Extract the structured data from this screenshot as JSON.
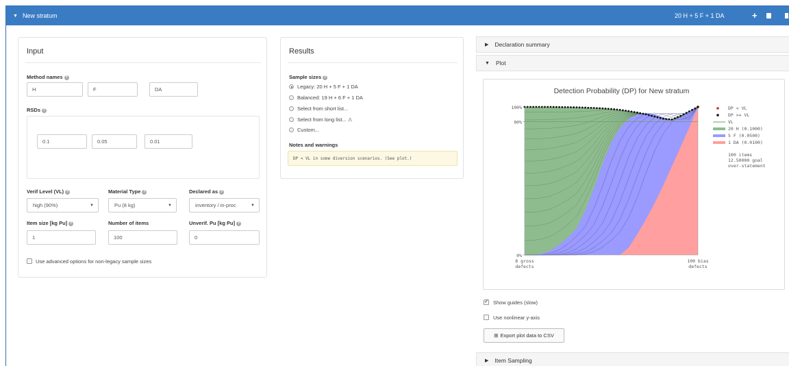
{
  "stratum": {
    "title": "New stratum",
    "summary": "20 H + 5 F + 1 DA"
  },
  "input": {
    "title": "Input",
    "method_names_label": "Method names",
    "methods": [
      "H",
      "F",
      "DA"
    ],
    "rsds_label": "RSDs",
    "rsds": [
      "0.1",
      "0.05",
      "0.01"
    ],
    "verif_level": {
      "label": "Verif Level (VL)",
      "value": "high (90%)"
    },
    "material_type": {
      "label": "Material Type",
      "value": "Pu (8 kg)"
    },
    "declared_as": {
      "label": "Declared as",
      "value": "inventory / in-proc"
    },
    "item_size": {
      "label": "Item size [kg Pu]",
      "value": "1"
    },
    "num_items": {
      "label": "Number of items",
      "value": "100"
    },
    "unverif": {
      "label": "Unverif. Pu [kg Pu]",
      "value": "0"
    },
    "advanced_label": "Use advanced options for non-legacy sample sizes"
  },
  "results": {
    "title": "Results",
    "sample_sizes_label": "Sample sizes",
    "options": [
      "Legacy: 20 H + 5 F + 1 DA",
      "Balanced: 19 H + 6 F + 1 DA",
      "Select from short list...",
      "Select from long list...",
      "Custom..."
    ],
    "selected_index": 0,
    "notes_label": "Notes and warnings",
    "warning": "DP < VL in some diversion scenarios. (See plot.)"
  },
  "right": {
    "declaration_summary": "Declaration summary",
    "plot": "Plot",
    "show_guides": "Show guides (slow)",
    "nonlinear": "Use nonlinear y-axis",
    "export": "Export plot data to CSV",
    "item_sampling": "Item Sampling"
  },
  "chart_data": {
    "type": "area",
    "title": "Detection Probability (DP) for New stratum",
    "y_ticks": [
      "100%",
      "90%",
      "0%"
    ],
    "x_labels": [
      "8 gross\ndefects",
      "100 bias\ndefects"
    ],
    "x_label_left": [
      "8 gross",
      "defects"
    ],
    "x_label_right": [
      "100 bias",
      "defects"
    ],
    "ylim": [
      0,
      1
    ],
    "vl": 0.9,
    "legend": [
      {
        "name": "DP < VL",
        "color": "#d62728",
        "kind": "dot"
      },
      {
        "name": "DP >= VL",
        "color": "#111111",
        "kind": "dot"
      },
      {
        "name": "VL",
        "color": "#6aa06a",
        "kind": "line"
      },
      {
        "name": "20 H (0.1000)",
        "color": "#8fbc8f",
        "kind": "band"
      },
      {
        "name": "5 F (0.0500)",
        "color": "#9a9aff",
        "kind": "band"
      },
      {
        "name": "1 DA (0.0100)",
        "color": "#ff9f9f",
        "kind": "band"
      }
    ],
    "annotation": [
      "100 items",
      "12.50000 goal",
      "over-statement"
    ],
    "series": [
      {
        "name": "20 H (0.1000)",
        "values": [
          1.0,
          1.0,
          1.0,
          1.0,
          0.999,
          0.998,
          0.997,
          0.995,
          0.993,
          0.99,
          0.986,
          0.98,
          0.972,
          0.962,
          0.95,
          0.935,
          0.92,
          0.915,
          0.94,
          0.97,
          1.0
        ]
      },
      {
        "name": "5 F (0.0500)",
        "values": [
          0.0,
          0.0,
          0.01,
          0.03,
          0.07,
          0.12,
          0.18,
          0.3,
          0.45,
          0.62,
          0.76,
          0.86,
          0.92,
          0.95,
          0.96,
          0.95,
          0.93,
          0.91,
          0.93,
          0.97,
          1.0
        ]
      },
      {
        "name": "1 DA (0.0100)",
        "values": [
          0.0,
          0.0,
          0.0,
          0.0,
          0.0,
          0.0,
          0.0,
          0.0,
          0.0,
          0.0,
          0.0,
          0.0,
          0.05,
          0.14,
          0.24,
          0.35,
          0.47,
          0.6,
          0.73,
          0.86,
          1.0
        ]
      }
    ]
  }
}
